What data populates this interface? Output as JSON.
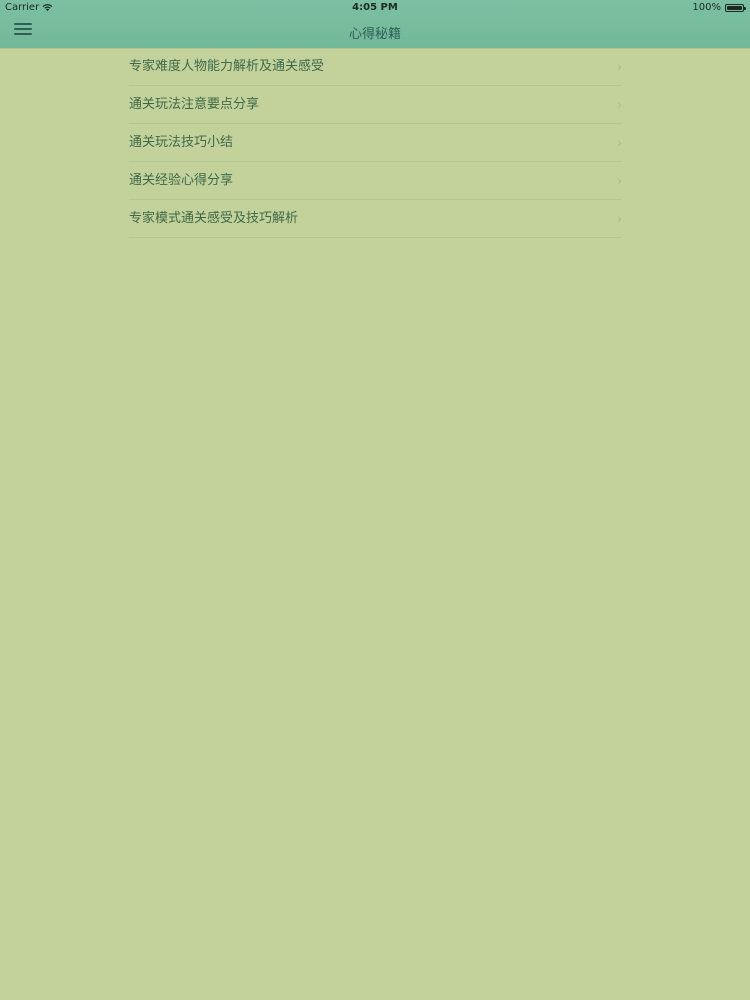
{
  "status_bar": {
    "carrier": "Carrier",
    "time": "4:05 PM",
    "battery_label": "100%",
    "battery_level": 1.0
  },
  "nav": {
    "title": "心得秘籍",
    "menu_icon": "hamburger-menu-icon"
  },
  "colors": {
    "background": "#c3d19b",
    "header": "#76bc9d",
    "title_text": "#2f5f58",
    "item_text": "#3e6a49"
  },
  "items": [
    {
      "label": "专家难度人物能力解析及通关感受"
    },
    {
      "label": "通关玩法注意要点分享"
    },
    {
      "label": "通关玩法技巧小结"
    },
    {
      "label": "通关经验心得分享"
    },
    {
      "label": "专家模式通关感受及技巧解析"
    }
  ]
}
